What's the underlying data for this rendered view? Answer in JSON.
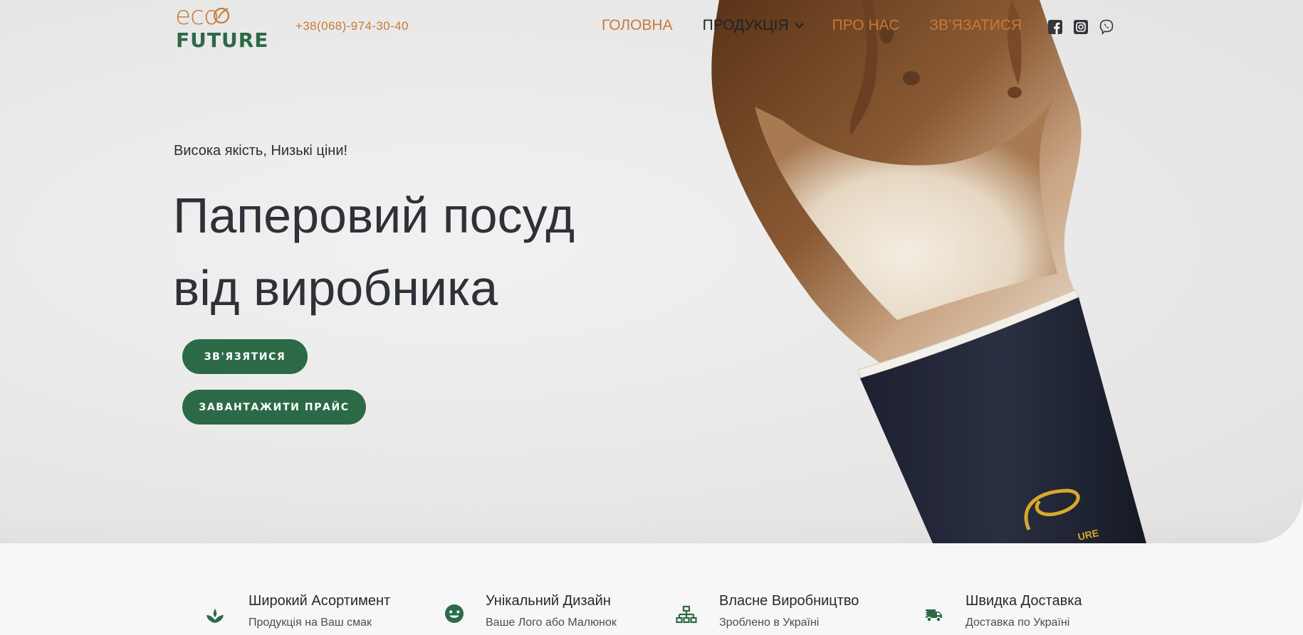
{
  "header": {
    "logo_top": "eco",
    "logo_bottom": "FUTURE",
    "phone": "+38(068)-974-30-40",
    "nav": [
      {
        "label": "ГОЛОВНА"
      },
      {
        "label": "ПРОДУКЦІЯ"
      },
      {
        "label": "ПРО НАС"
      },
      {
        "label": "ЗВ’ЯЗАТИСЯ"
      }
    ],
    "social_icons": [
      "facebook-icon",
      "instagram-icon",
      "viber-icon"
    ]
  },
  "hero": {
    "tagline": "Висока якість, Низькі ціни!",
    "headline_line1": "Паперовий посуд",
    "headline_line2": "від виробника",
    "button_contact": "ЗВ'ЯЗЯТИСЯ",
    "button_price": "ЗАВАНТАЖИТИ ПРАЙС",
    "cup_brand_text": "URE"
  },
  "features": [
    {
      "icon": "leaf-icon",
      "title": "Широкий Асортимент",
      "subtitle": "Продукція на Ваш смак"
    },
    {
      "icon": "smiley-icon",
      "title": "Унікальний Дизайн",
      "subtitle": "Ваше Лого або Малюнок"
    },
    {
      "icon": "network-icon",
      "title": "Власне Виробництво",
      "subtitle": "Зроблено в Україні"
    },
    {
      "icon": "truck-icon",
      "title": "Швидка Доставка",
      "subtitle": "Доставка по Україні"
    }
  ],
  "colors": {
    "accent_orange": "#c97a35",
    "brand_green": "#2c6a47",
    "text_dark": "#2e3138"
  }
}
